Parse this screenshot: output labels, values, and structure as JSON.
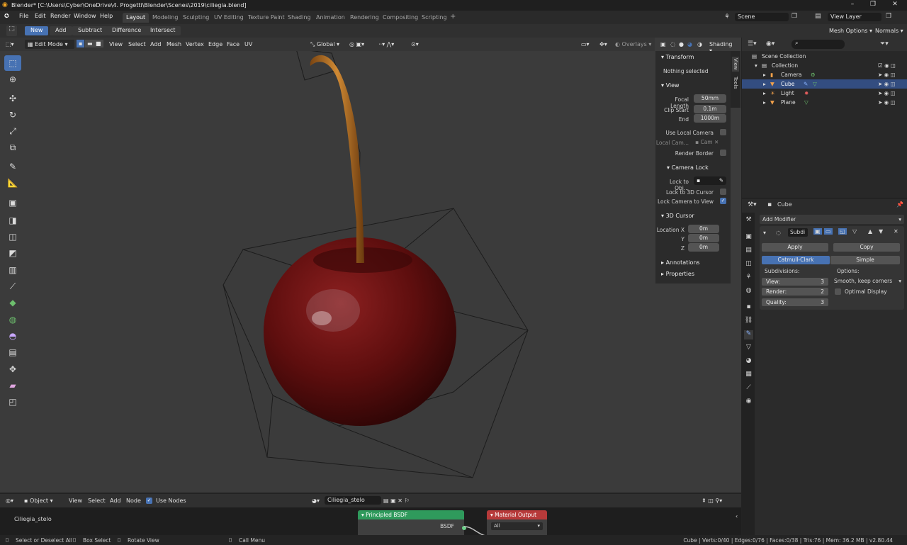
{
  "window": {
    "title": "Blender* [C:\\Users\\Cyber\\OneDrive\\4. Progetti\\Blender\\Scenes\\2019\\ciliegia.blend]"
  },
  "menu": [
    "File",
    "Edit",
    "Render",
    "Window",
    "Help"
  ],
  "workspaces": [
    "Layout",
    "Modeling",
    "Sculpting",
    "UV Editing",
    "Texture Paint",
    "Shading",
    "Animation",
    "Rendering",
    "Compositing",
    "Scripting"
  ],
  "workspace_add": "+",
  "scene": "Scene",
  "view_layer": "View Layer",
  "tool_header": {
    "buttons": [
      "New",
      "Add",
      "Subtract",
      "Difference",
      "Intersect"
    ],
    "mesh_options": "Mesh Options",
    "normals": "Normals"
  },
  "viewport": {
    "mode": "Edit Mode",
    "menus": [
      "View",
      "Select",
      "Add",
      "Mesh",
      "Vertex",
      "Edge",
      "Face",
      "UV"
    ],
    "transform_orientation": "Global",
    "overlays": "Overlays",
    "shading": "Shading"
  },
  "npanel": {
    "tabs": [
      "View",
      "Tools"
    ],
    "transform": {
      "title": "Transform",
      "status": "Nothing selected"
    },
    "view": {
      "title": "View",
      "focal_length_label": "Focal Length",
      "focal_length": "50mm",
      "clip_start_label": "Clip Start",
      "clip_start": "0.1m",
      "end_label": "End",
      "end": "1000m",
      "use_local_camera": "Use Local Camera",
      "local_camera_label": "Local Cam...",
      "local_camera_value": "Cam",
      "render_border": "Render Border"
    },
    "camera_lock": {
      "title": "Camera Lock",
      "lock_to_object": "Lock to Obj...",
      "lock_to_cursor": "Lock to 3D Cursor",
      "lock_camera_to_view": "Lock Camera to View"
    },
    "cursor": {
      "title": "3D Cursor",
      "location_label": "Location X",
      "x": "0m",
      "y_label": "Y",
      "y": "0m",
      "z_label": "Z",
      "z": "0m"
    },
    "annotations": "Annotations",
    "properties": "Properties"
  },
  "outliner": {
    "scene_collection": "Scene Collection",
    "collection": "Collection",
    "items": [
      "Camera",
      "Cube",
      "Light",
      "Plane"
    ]
  },
  "properties": {
    "object_name": "Cube",
    "add_modifier": "Add Modifier",
    "modifier_name": "Subdi",
    "apply": "Apply",
    "copy": "Copy",
    "catmull": "Catmull-Clark",
    "simple": "Simple",
    "subdivisions_label": "Subdivisions:",
    "options_label": "Options:",
    "view_label": "View:",
    "view_value": "3",
    "render_label": "Render:",
    "render_value": "2",
    "quality_label": "Quality:",
    "quality_value": "3",
    "smooth_option": "Smooth, keep corners",
    "optimal_display": "Optimal Display"
  },
  "node_editor": {
    "type": "Object",
    "menus": [
      "View",
      "Select",
      "Add",
      "Node"
    ],
    "use_nodes": "Use Nodes",
    "material": "Ciliegia_stelo",
    "breadcrumb": "Ciliegia_stelo",
    "node1_title": "Principled BSDF",
    "node1_output": "BSDF",
    "node2_title": "Material Output",
    "node2_target": "All"
  },
  "statusbar": {
    "left1": "Select or Deselect All",
    "left2": "Box Select",
    "left3": "Rotate View",
    "left4": "Call Menu",
    "stats": "Cube | Verts:0/40 | Edges:0/76 | Faces:0/38 | Tris:76 | Mem: 36.2 MB | v2.80.44"
  },
  "colors": {
    "accent": "#4772b3",
    "cherry": "#7a1515",
    "stem": "#b06a1e",
    "node_green": "#2f9a5c",
    "node_red": "#b73a3a"
  }
}
